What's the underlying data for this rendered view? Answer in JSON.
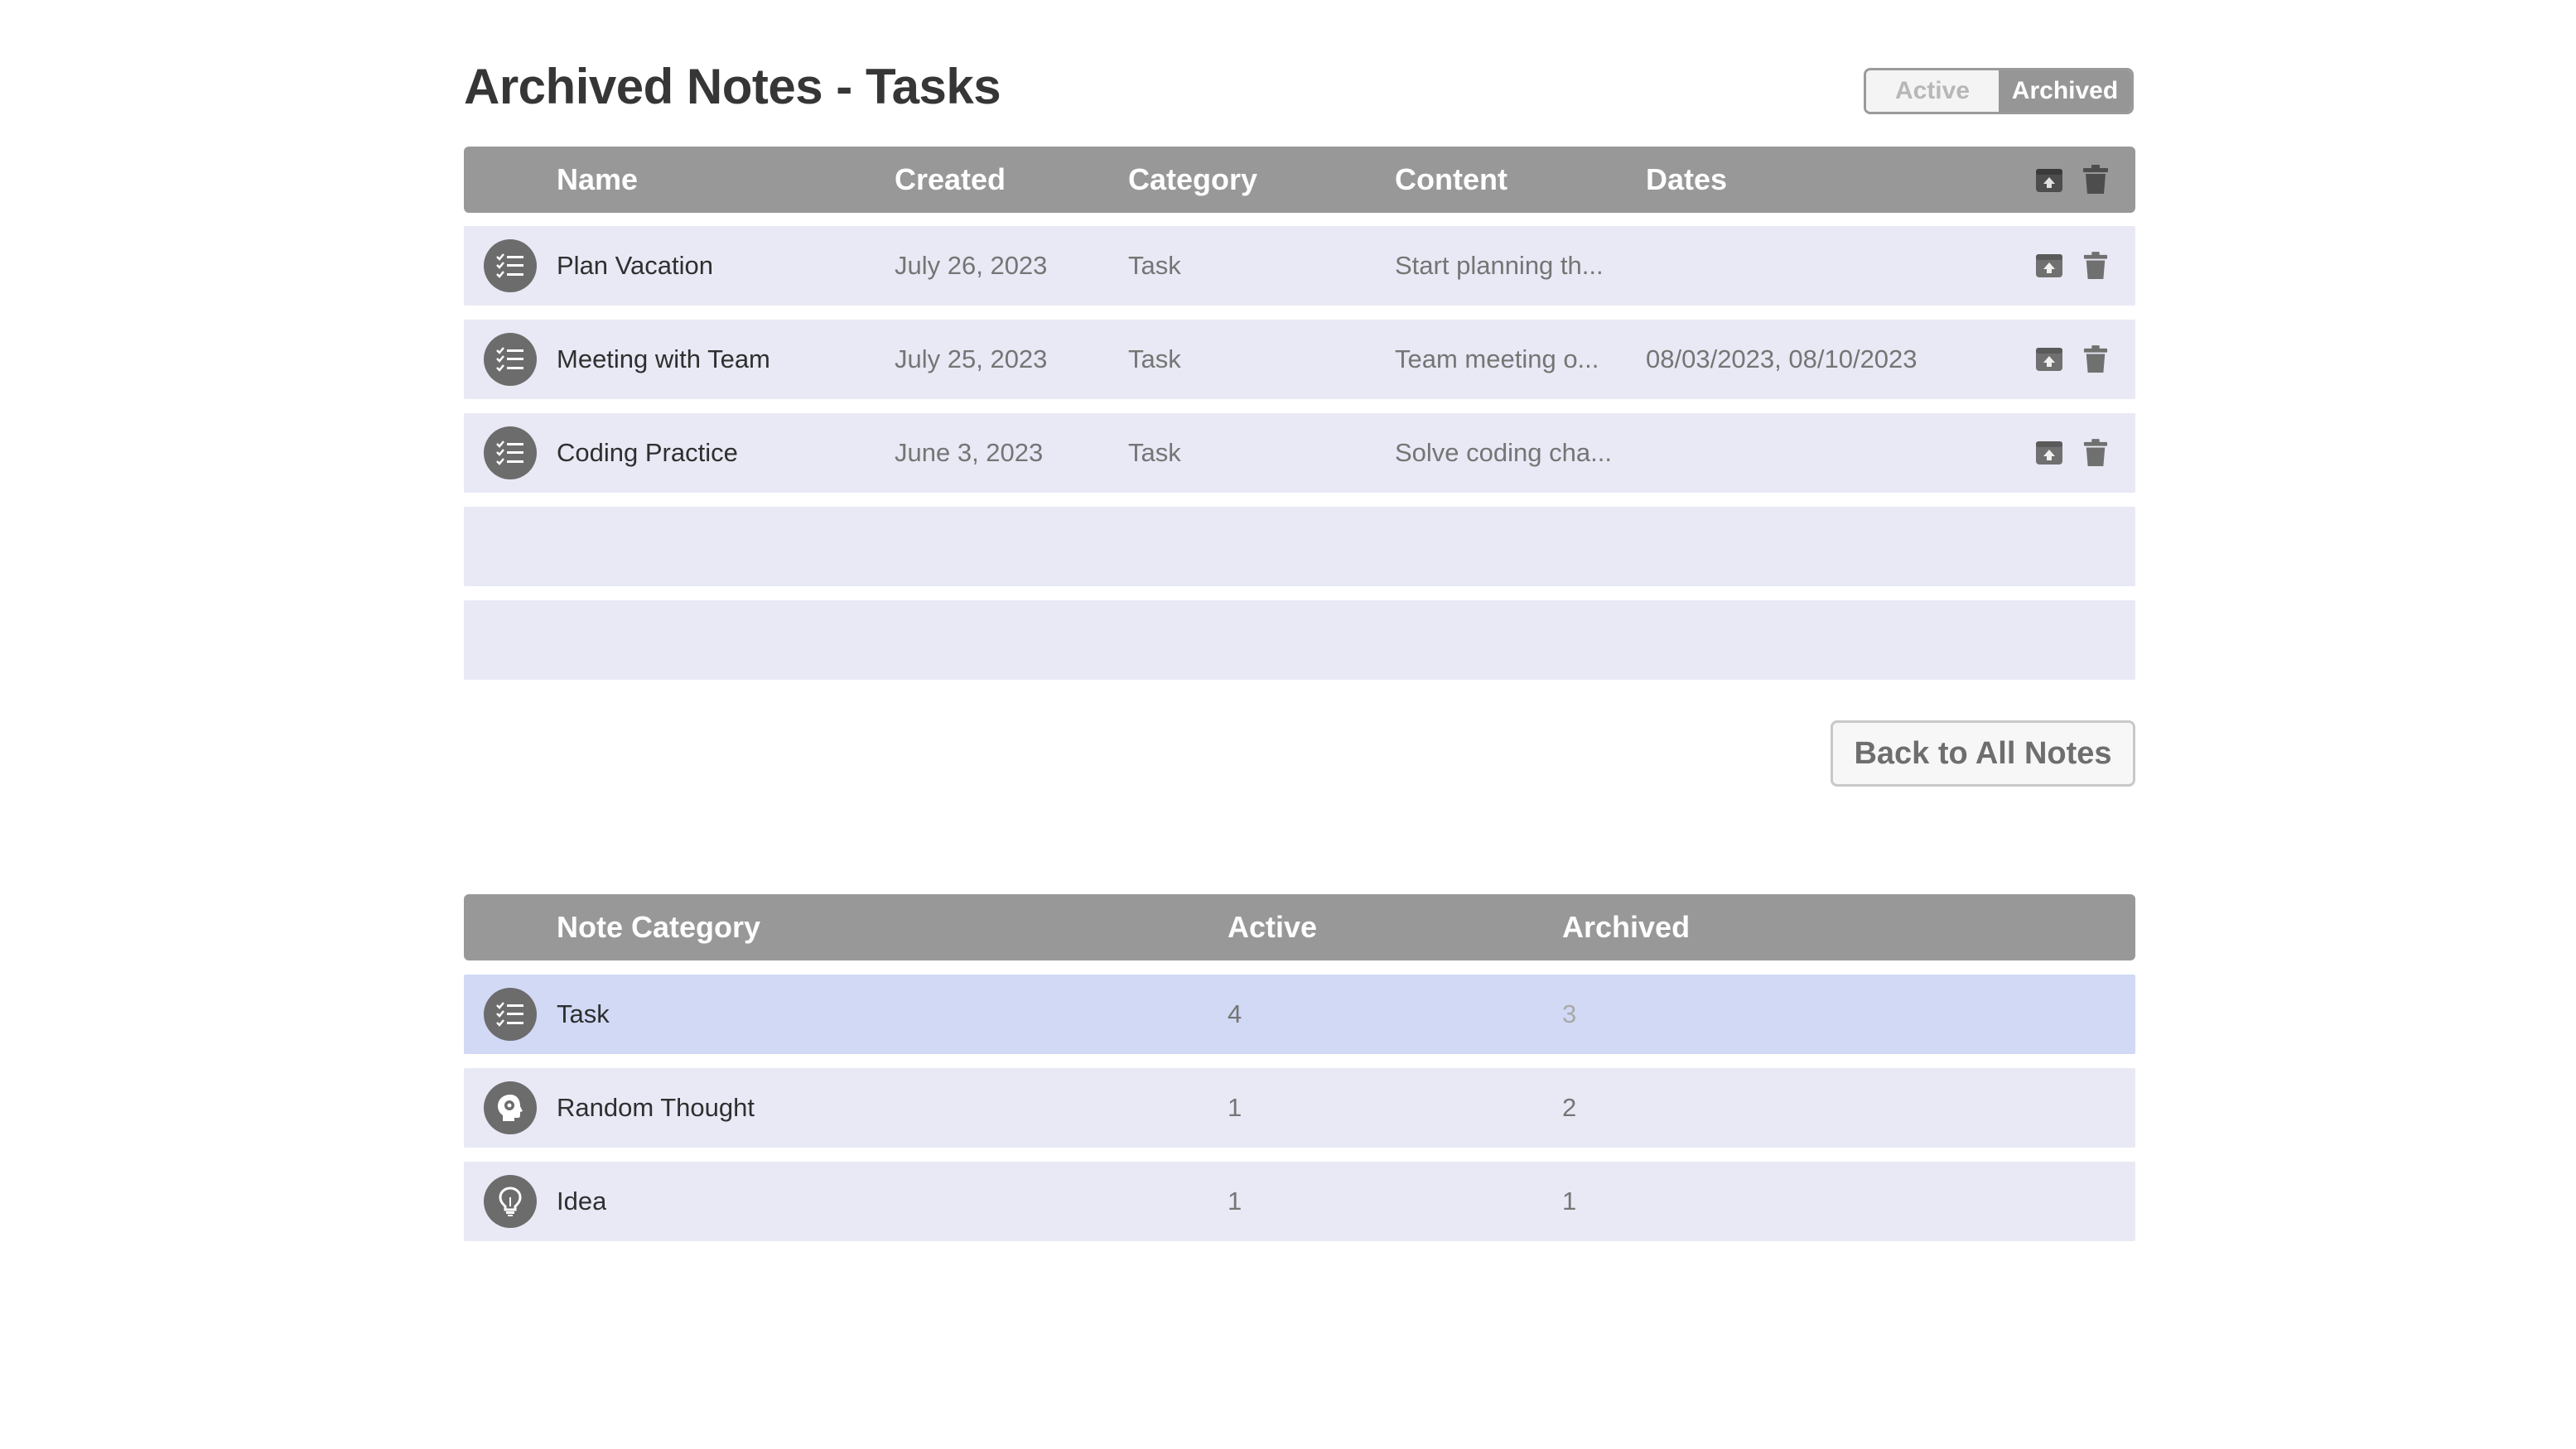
{
  "page_title": "Archived Notes - Tasks",
  "toggle": {
    "active_label": "Active",
    "archived_label": "Archived",
    "selected": "Archived"
  },
  "notes_table": {
    "headers": {
      "name": "Name",
      "created": "Created",
      "category": "Category",
      "content": "Content",
      "dates": "Dates"
    },
    "header_icons": [
      "unarchive-icon",
      "trash-icon"
    ],
    "rows": [
      {
        "icon": "task-list-icon",
        "name": "Plan Vacation",
        "created": "July 26, 2023",
        "category": "Task",
        "content": "Start planning th...",
        "dates": ""
      },
      {
        "icon": "task-list-icon",
        "name": "Meeting with Team",
        "created": "July 25, 2023",
        "category": "Task",
        "content": "Team meeting o...",
        "dates": "08/03/2023, 08/10/2023"
      },
      {
        "icon": "task-list-icon",
        "name": "Coding Practice",
        "created": "June 3, 2023",
        "category": "Task",
        "content": "Solve coding cha...",
        "dates": ""
      }
    ],
    "row_actions": [
      "unarchive-icon",
      "trash-icon"
    ]
  },
  "back_button": "Back to All Notes",
  "summary_table": {
    "headers": {
      "category": "Note Category",
      "active": "Active",
      "archived": "Archived"
    },
    "rows": [
      {
        "icon": "task-list-icon",
        "category": "Task",
        "active": "4",
        "archived": "3",
        "highlighted": true
      },
      {
        "icon": "brain-icon",
        "category": "Random Thought",
        "active": "1",
        "archived": "2",
        "highlighted": false
      },
      {
        "icon": "lightbulb-icon",
        "category": "Idea",
        "active": "1",
        "archived": "1",
        "highlighted": false
      }
    ]
  },
  "colors": {
    "header_bg": "#989898",
    "row_bg": "#e8e9f5",
    "row_highlight_bg": "#d1d9f5",
    "icon_bg": "#6c6c6c"
  }
}
